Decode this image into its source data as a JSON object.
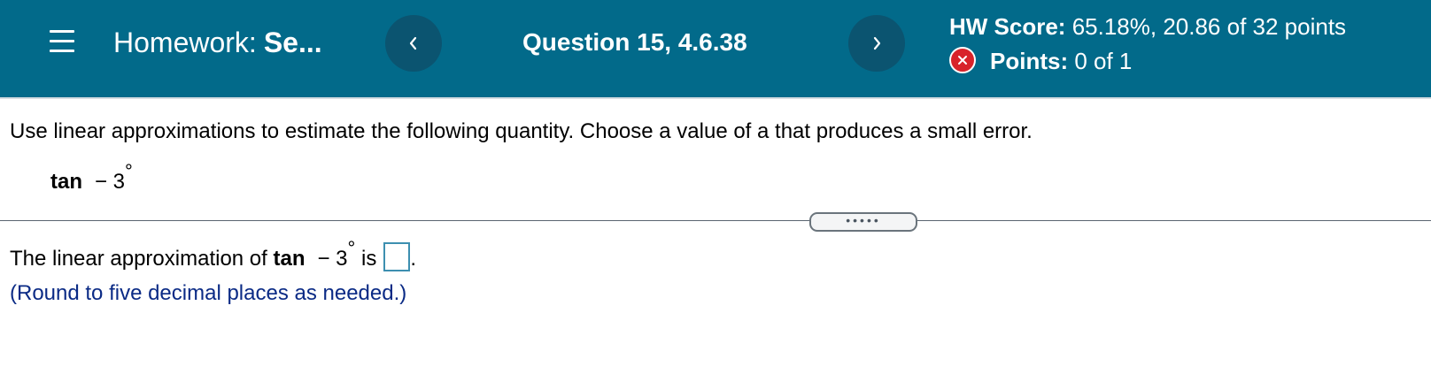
{
  "header": {
    "menu_icon": "hamburger-menu-icon",
    "homework_label": "Homework:",
    "homework_name": "Se...",
    "prev_icon": "chevron-left-icon",
    "question_title": "Question 15, 4.6.38",
    "next_icon": "chevron-right-icon",
    "score_label": "HW Score:",
    "score_value": "65.18%, 20.86 of 32 points",
    "points_icon": "incorrect-x-icon",
    "points_label": "Points:",
    "points_value": "0 of 1",
    "colors": {
      "background": "#026a8a",
      "nav_button": "#0b5470",
      "incorrect": "#d8232a"
    }
  },
  "question": {
    "instruction": "Use linear approximations to estimate the following quantity. Choose a value of a that produces a small error.",
    "expression_fn": "tan",
    "expression_arg": "− 3",
    "expression_unit": "°"
  },
  "more_handle": {
    "dots": "•••••"
  },
  "answer": {
    "prefix": "The linear approximation of",
    "fn": "tan",
    "arg": "− 3",
    "unit": "°",
    "is": "is",
    "value": "",
    "period": ".",
    "hint": "(Round to five decimal places as needed.)",
    "hint_color": "#0a2a85"
  }
}
